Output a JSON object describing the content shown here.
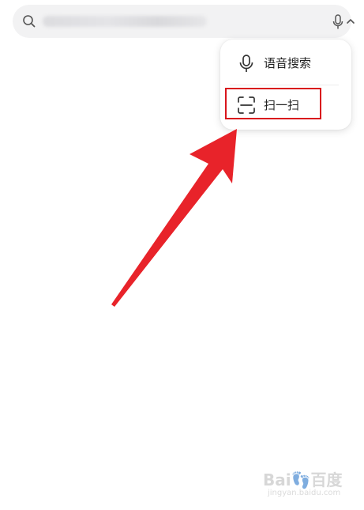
{
  "search": {
    "query_blurred": true,
    "icons": [
      "search-icon",
      "mic-icon",
      "chevron-up-icon"
    ]
  },
  "menu": {
    "items": [
      {
        "label": "语音搜索",
        "icon": "mic-icon"
      },
      {
        "label": "扫一扫",
        "icon": "scan-icon"
      }
    ]
  },
  "annotation": {
    "highlight_color": "#d9151c",
    "arrow_color": "#e8232a"
  },
  "watermark": {
    "logo": "Bai👣百度",
    "sub": "jingyan.baidu.com"
  }
}
